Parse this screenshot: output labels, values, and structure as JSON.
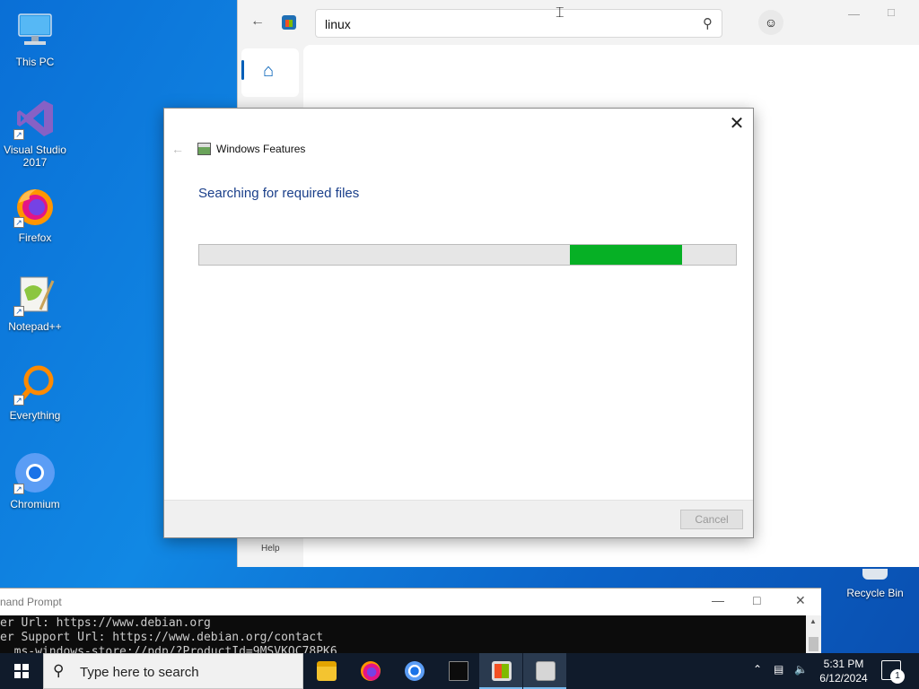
{
  "desktop": {
    "icons": [
      {
        "label": "This PC"
      },
      {
        "label": "Visual Studio 2017"
      },
      {
        "label": "Firefox"
      },
      {
        "label": "Notepad++"
      },
      {
        "label": "Everything"
      },
      {
        "label": "Chromium"
      }
    ],
    "recycle_bin": "Recycle Bin"
  },
  "store": {
    "search_value": "linux",
    "help_label": "Help"
  },
  "dialog": {
    "title": "Windows Features",
    "heading": "Searching for required files",
    "progress": {
      "fill_start_percent": 69,
      "fill_end_percent": 90
    },
    "cancel_label": "Cancel"
  },
  "cmd": {
    "title": "nand Prompt",
    "lines": [
      "er Url: https://www.debian.org",
      "er Support Url: https://www.debian.org/contact",
      "  ms-windows-store://pdp/?ProductId=9MSVKQC78PK6"
    ]
  },
  "taskbar": {
    "search_placeholder": "Type here to search",
    "time": "5:31 PM",
    "date": "6/12/2024",
    "notification_count": "1"
  }
}
